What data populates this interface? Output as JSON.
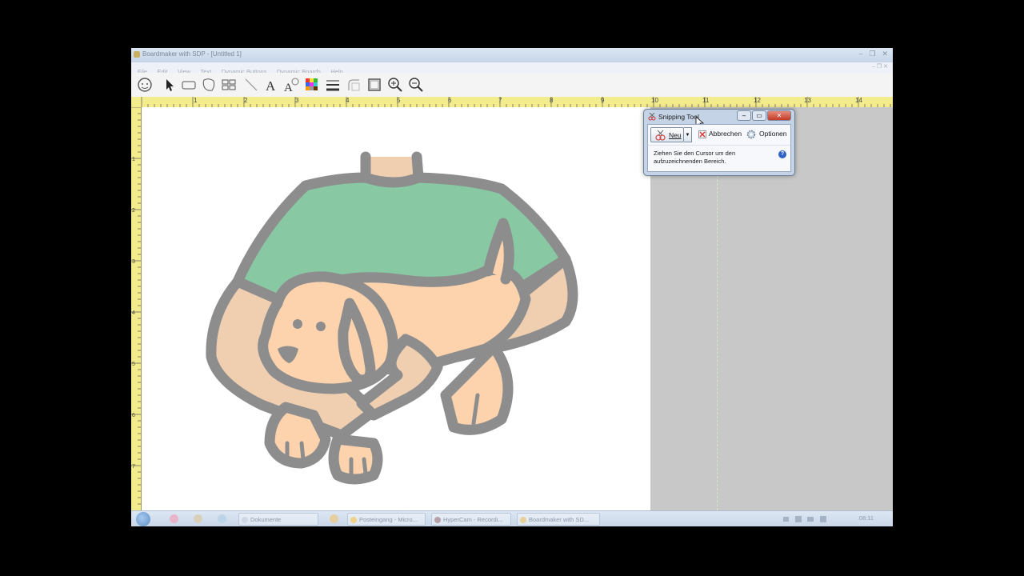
{
  "window": {
    "title": "Boardmaker with SDP - [Untitled 1]",
    "controls": [
      "–",
      "❐",
      "✕"
    ],
    "mdi_controls": "– ❐ ✕"
  },
  "menu": [
    "File",
    "Edit",
    "View",
    "Text",
    "Dynamic Buttons",
    "Dynamic Boards",
    "Help"
  ],
  "toolbar": {
    "tools": [
      "symbol-finder-icon",
      "pointer-icon",
      "button-icon",
      "freeform-icon",
      "button-sequence-icon",
      "line-icon",
      "text-icon",
      "symbol-text-icon",
      "color-palette-icon",
      "line-thickness-icon",
      "corners-icon",
      "shadow-icon",
      "zoom-in-icon",
      "zoom-out-icon"
    ]
  },
  "ruler": {
    "horizontal": [
      "1",
      "2",
      "3",
      "4",
      "5",
      "6",
      "7",
      "8",
      "9",
      "10",
      "11",
      "12",
      "13",
      "14"
    ],
    "vertical": [
      "1",
      "2",
      "3",
      "4",
      "5",
      "6",
      "7"
    ]
  },
  "snipping_tool": {
    "title": "Snipping Tool",
    "new_label": "Neu",
    "cancel_label": "Abbrechen",
    "options_label": "Optionen",
    "message": "Ziehen Sie den Cursor um den aufzuzeichnenden Bereich.",
    "help": "?"
  },
  "taskbar": {
    "items": [
      "Dokumente",
      "Posteingang - Micro...",
      "HyperCam - Recordi...",
      "Boardmaker with SD..."
    ],
    "time": "08:11"
  },
  "colors": {
    "shirt": "#88c8a3",
    "skin": "#f0cfb1",
    "dog": "#fdd3ad",
    "outline": "#8d8d8d",
    "ruler": "#f3ec8c"
  }
}
